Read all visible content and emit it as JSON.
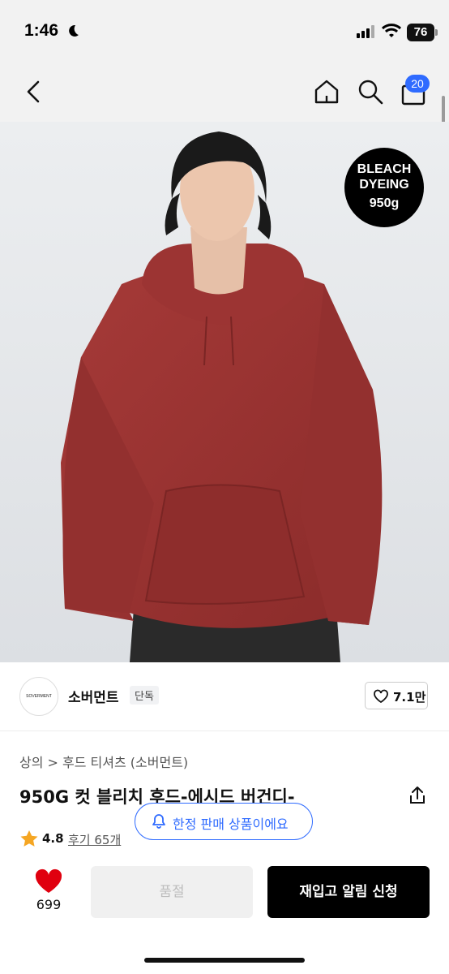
{
  "status": {
    "time": "1:46",
    "battery": "76"
  },
  "nav": {
    "cart_count": "20"
  },
  "hero": {
    "badge_line1": "BLEACH",
    "badge_line2": "DYEING",
    "badge_line3": "950g"
  },
  "brand": {
    "logo_text": "SOVERMENT",
    "name": "소버먼트",
    "exclusive": "단독",
    "likes": "7.1만"
  },
  "product": {
    "breadcrumb": "상의 > 후드 티셔츠 (소버먼트)",
    "title": "950G 컷 블리치 후드-에시드 버건디-",
    "rating": "4.8",
    "reviews": "후기 65개"
  },
  "toast": {
    "label": "한정 판매 상품이에요"
  },
  "bottom": {
    "heart_count": "699",
    "soldout_label": "품절",
    "restock_label": "재입고 알림 신청"
  },
  "colors": {
    "accent": "#2f6bff",
    "hoodie": "#9b2f2f",
    "star": "#f5a623",
    "heart": "#e0000f"
  }
}
